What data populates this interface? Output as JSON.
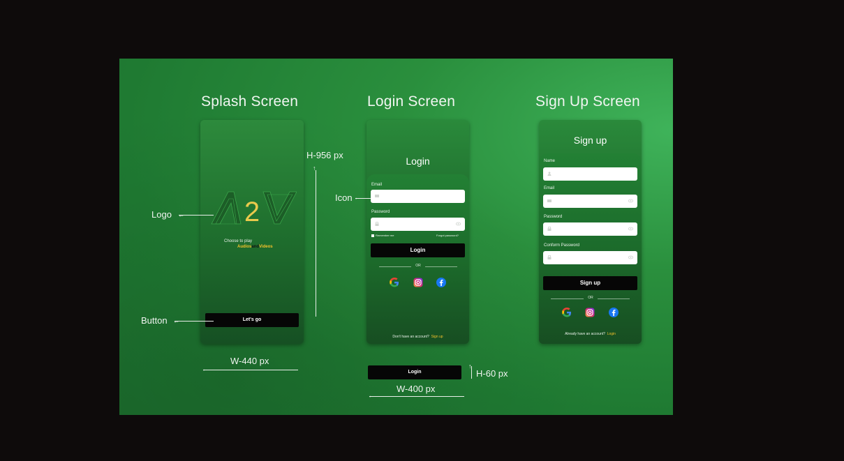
{
  "sections": {
    "splash_title": "Splash Screen",
    "login_title": "Login Screen",
    "signup_title": "Sign Up Screen"
  },
  "splash": {
    "logo_text": "A2V",
    "tagline_top": "Choose to play",
    "tagline_audios": "Audios",
    "tagline_and": "and",
    "tagline_videos": "Videos",
    "button_label": "Let's go"
  },
  "login": {
    "heading": "Login",
    "email_label": "Email",
    "password_label": "Password",
    "remember_label": "Remember me",
    "forgot_label": "Forgot password?",
    "button_label": "Login",
    "or_label": "OR",
    "footer_prefix": "Don't have an account?",
    "footer_link": "Sign up",
    "social": [
      "google-icon",
      "instagram-icon",
      "facebook-icon"
    ]
  },
  "signup": {
    "heading": "Sign up",
    "name_label": "Name",
    "email_label": "Email",
    "password_label": "Password",
    "confirm_label": "Conform Password",
    "button_label": "Sign up",
    "or_label": "OR",
    "footer_prefix": "Already have an account?",
    "footer_link": "Login"
  },
  "annotations": {
    "logo": "Logo",
    "button": "Button",
    "icon": "Icon",
    "height_screen": "H-956 px",
    "width_screen": "W-440 px",
    "standalone_button": "Login",
    "height_button": "H-60 px",
    "width_button": "W-400 px"
  },
  "colors": {
    "accent_yellow": "#f3c12b",
    "button_black": "#060606",
    "logo_green": "#1f6b2b",
    "logo_gold": "#e9c94c"
  }
}
